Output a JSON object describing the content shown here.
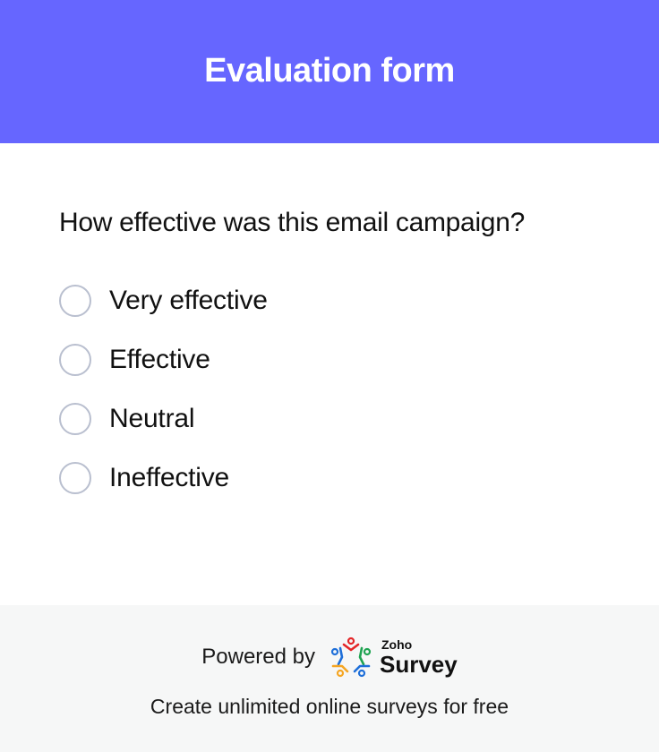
{
  "header": {
    "title": "Evaluation form",
    "background_color": "#6666ff"
  },
  "question": {
    "text": "How effective was this email campaign?",
    "options": [
      {
        "label": "Very effective",
        "selected": false
      },
      {
        "label": "Effective",
        "selected": false
      },
      {
        "label": "Neutral",
        "selected": false
      },
      {
        "label": "Ineffective",
        "selected": false
      }
    ]
  },
  "footer": {
    "powered_by": "Powered by",
    "logo_small": "Zoho",
    "logo_big": "Survey",
    "logo_icon": "zoho-survey-logo-icon",
    "tagline": "Create unlimited online surveys for free",
    "background_color": "#f6f7f7"
  }
}
